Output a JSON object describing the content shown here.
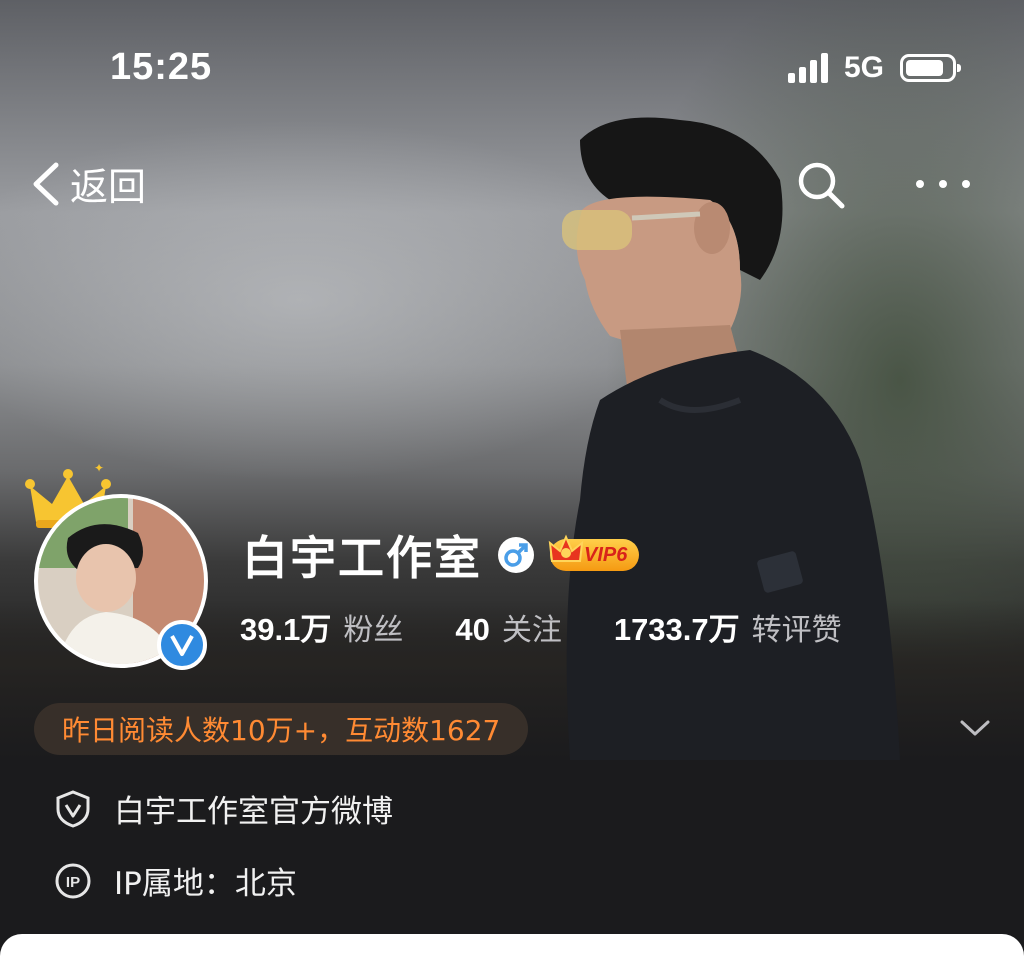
{
  "status_bar": {
    "time": "15:25",
    "network": "5G",
    "signal_bars": 4,
    "battery_level": 0.85,
    "icons": [
      "signal-icon",
      "battery-icon"
    ]
  },
  "nav": {
    "back_label": "返回",
    "icons": [
      "back-chevron-icon",
      "search-icon",
      "more-icon"
    ]
  },
  "profile": {
    "name": "白宇工作室",
    "gender": "male",
    "vip_label": "VIP6",
    "verified": true,
    "stats": [
      {
        "value": "39.1万",
        "label": "粉丝"
      },
      {
        "value": "40",
        "label": "关注"
      },
      {
        "value": "1733.7万",
        "label": "转评赞"
      }
    ],
    "highlight": "昨日阅读人数10万+，互动数1627",
    "description": "白宇工作室官方微博",
    "ip_location": "IP属地：北京"
  },
  "colors": {
    "accent_orange": "#ff8a33",
    "verified_blue": "#2f8ae0",
    "gender_blue": "#4a9ee8",
    "vip_gold": "#f5a623",
    "background": "#1b1b1d"
  }
}
